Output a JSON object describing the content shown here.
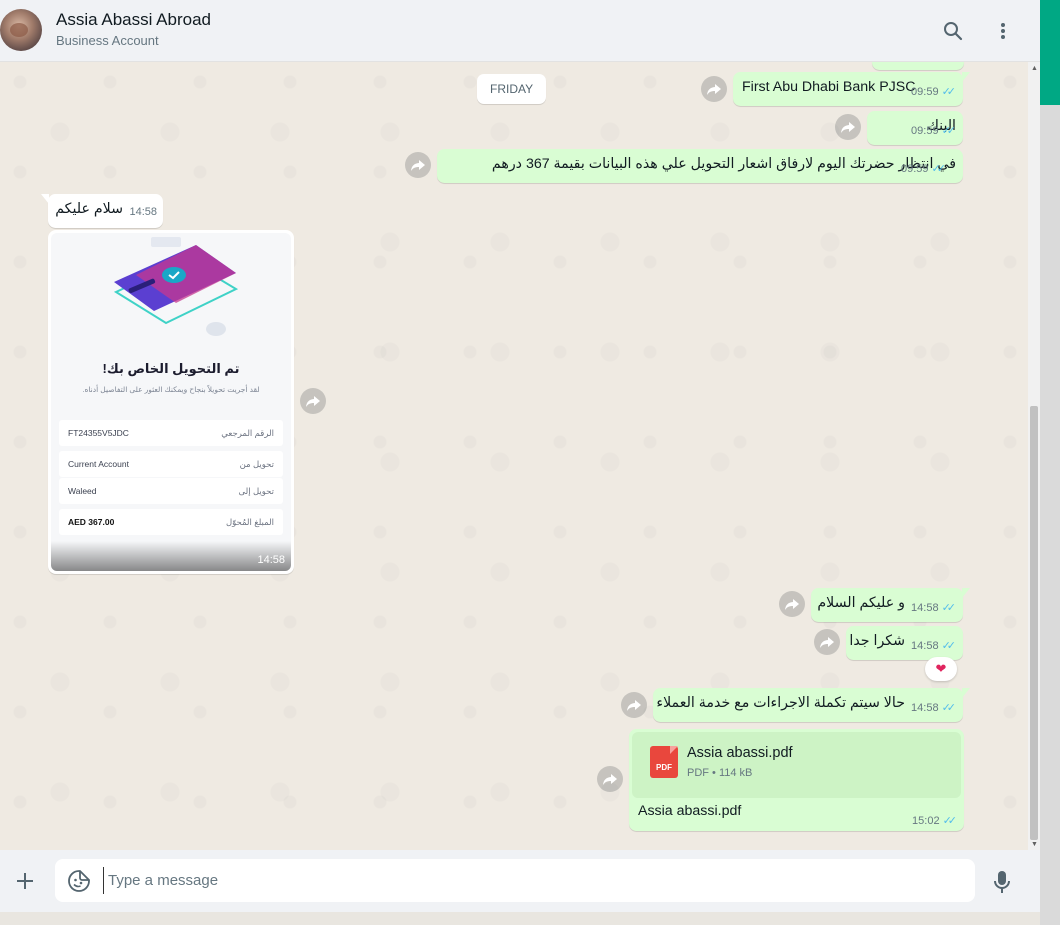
{
  "header": {
    "contact_name": "Assia Abassi Abroad",
    "contact_subtitle": "Business Account",
    "icons": [
      "search-icon",
      "menu-icon"
    ]
  },
  "chat": {
    "date_chip": "FRIDAY",
    "messages": [
      {
        "dir": "out",
        "text": "First Abu Dhabi Bank PJSC",
        "time": "09:59",
        "status": "read"
      },
      {
        "dir": "out",
        "text": "البنك",
        "time": "09:59",
        "status": "read"
      },
      {
        "dir": "out",
        "text": "في انتظار حضرتك اليوم لارفاق اشعار التحويل علي هذه البيانات بقيمة 367 درهم",
        "time": "09:59",
        "status": "read"
      },
      {
        "dir": "in",
        "text": "سلام عليكم",
        "time": "14:58"
      },
      {
        "dir": "in",
        "type": "image",
        "time": "14:58"
      },
      {
        "dir": "out",
        "text": "و عليكم السلام",
        "time": "14:58",
        "status": "read"
      },
      {
        "dir": "out",
        "text": "شكرا جدا",
        "time": "14:58",
        "status": "read",
        "reaction": "❤️"
      },
      {
        "dir": "out",
        "text": "حالا سيتم تكملة الاجراءات مع خدمة العملاء",
        "time": "14:58",
        "status": "read"
      },
      {
        "dir": "out",
        "type": "document",
        "time": "15:02",
        "status": "read"
      }
    ],
    "receipt": {
      "title": "تم التحويل الخاص بك!",
      "subtitle": "لقد أجريت تحويلاً بنجاح ويمكنك العثور على التفاصيل أدناه.",
      "rows": [
        {
          "label": "الرقم المرجعي",
          "value": "FT24355V5JDC"
        },
        {
          "label": "تحويل من",
          "value": "Current Account"
        },
        {
          "label": "تحويل إلى",
          "value": "Waleed"
        },
        {
          "label": "المبلغ المُحوّل",
          "value": "AED 367.00"
        }
      ]
    },
    "reaction": "❤",
    "document": {
      "file_name": "Assia abassi.pdf",
      "file_meta": "PDF • 114 kB",
      "icon_label": "PDF",
      "caption": "Assia abassi.pdf"
    }
  },
  "footer": {
    "placeholder": "Type a message",
    "value": ""
  },
  "colors": {
    "outgoing_bubble": "#d9fdd3",
    "incoming_bubble": "#ffffff",
    "read_ticks": "#53bdeb",
    "accent": "#00a884",
    "pdf_red": "#e9473d"
  }
}
